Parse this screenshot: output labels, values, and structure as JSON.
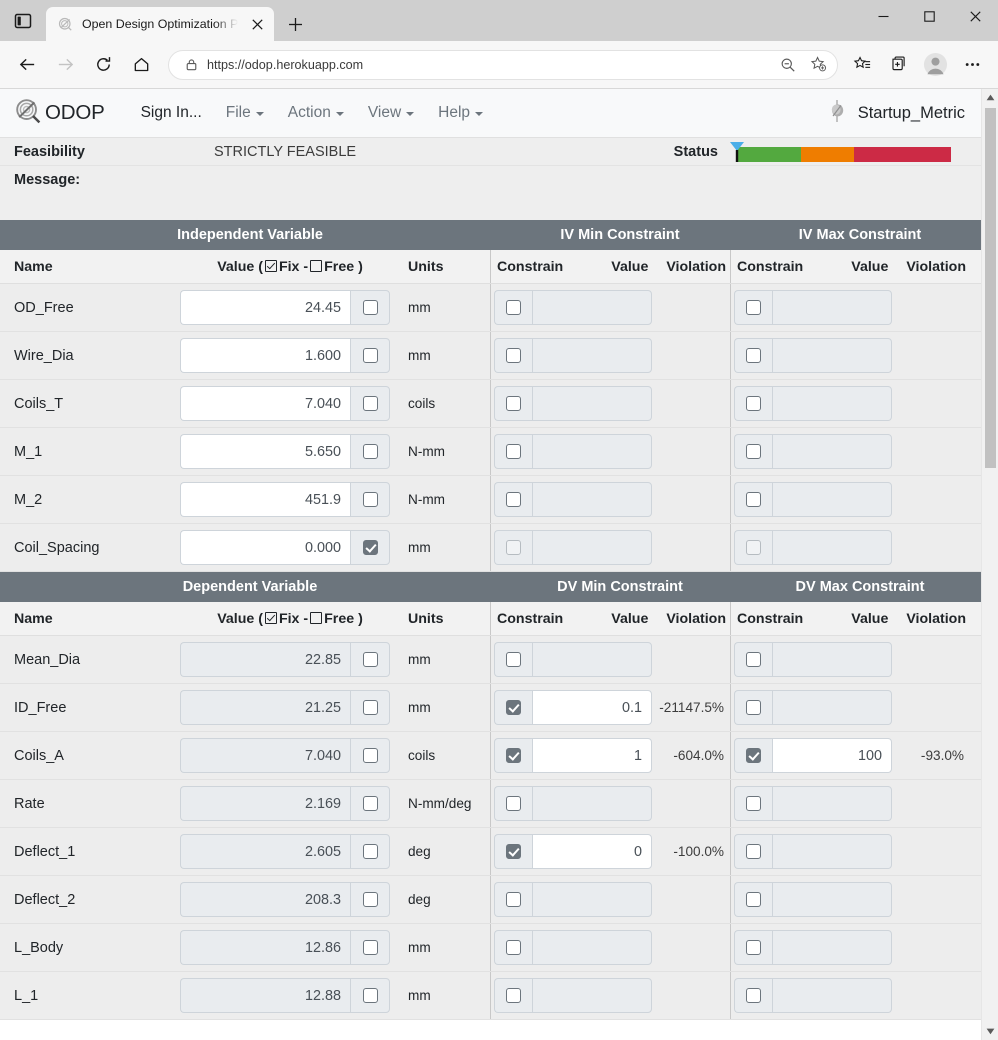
{
  "browser": {
    "tab": {
      "title": "Open Design Optimization Platfo",
      "favicon_icon": "odop-spiral-icon",
      "close_icon": "close-icon",
      "new_tab_icon": "plus-icon",
      "sidebar_icon": "tab-sidebar-icon"
    },
    "window_controls": {
      "minimize_icon": "minimize-icon",
      "maximize_icon": "maximize-icon",
      "close_icon": "close-icon"
    },
    "toolbar": {
      "back_icon": "back-arrow-icon",
      "forward_icon": "forward-arrow-icon",
      "refresh_icon": "refresh-icon",
      "home_icon": "home-icon",
      "lock_icon": "lock-icon",
      "url": "https://odop.herokuapp.com",
      "zoom_icon": "zoom-out-icon",
      "add_favorite_icon": "add-favorite-star-icon",
      "favorites_icon": "favorites-list-icon",
      "collections_icon": "collections-icon",
      "profile_icon": "profile-avatar-icon",
      "settings_icon": "more-ellipsis-icon"
    },
    "scrollbar": {
      "up_icon": "scroll-up-arrow-icon",
      "down_icon": "scroll-down-arrow-icon"
    }
  },
  "app": {
    "brand": {
      "name": "ODOP",
      "logo_icon": "odop-spiral-logo-icon"
    },
    "nav": [
      {
        "label": "Sign In...",
        "has_caret": false,
        "name": "sign-in"
      },
      {
        "label": "File",
        "has_caret": true,
        "name": "file"
      },
      {
        "label": "Action",
        "has_caret": true,
        "name": "action"
      },
      {
        "label": "View",
        "has_caret": true,
        "name": "view"
      },
      {
        "label": "Help",
        "has_caret": true,
        "name": "help"
      }
    ],
    "model": {
      "name": "Startup_Metric",
      "icon": "spring-model-icon"
    },
    "status": {
      "feasibility_label": "Feasibility",
      "feasibility_value": "STRICTLY FEASIBLE",
      "message_label": "Message:",
      "message_value": "",
      "status_label": "Status",
      "marker_icon": "status-marker-triangle-icon",
      "marker_position_pct": 0,
      "segments": [
        {
          "color": "#53a93f",
          "width_pct": 30
        },
        {
          "color": "#ef7d00",
          "width_pct": 25
        },
        {
          "color": "#cc2a45",
          "width_pct": 45
        }
      ]
    }
  },
  "sections": [
    {
      "group_headers": [
        "Independent Variable",
        "IV Min Constraint",
        "IV Max Constraint"
      ],
      "column_headers": {
        "name": "Name",
        "value_prefix": "Value (",
        "value_fix": "Fix",
        "value_dash": "-",
        "value_free": "Free",
        "value_suffix": ")",
        "units": "Units",
        "constrain": "Constrain",
        "cvalue": "Value",
        "violation": "Violation"
      },
      "rows": [
        {
          "name": "OD_Free",
          "value": "24.45",
          "fix": false,
          "units": "mm",
          "min": {
            "constrain": false,
            "value": "",
            "violation": ""
          },
          "max": {
            "constrain": false,
            "value": "",
            "violation": ""
          }
        },
        {
          "name": "Wire_Dia",
          "value": "1.600",
          "fix": false,
          "units": "mm",
          "min": {
            "constrain": false,
            "value": "",
            "violation": ""
          },
          "max": {
            "constrain": false,
            "value": "",
            "violation": ""
          }
        },
        {
          "name": "Coils_T",
          "value": "7.040",
          "fix": false,
          "units": "coils",
          "min": {
            "constrain": false,
            "value": "",
            "violation": ""
          },
          "max": {
            "constrain": false,
            "value": "",
            "violation": ""
          }
        },
        {
          "name": "M_1",
          "value": "5.650",
          "fix": false,
          "units": "N-mm",
          "min": {
            "constrain": false,
            "value": "",
            "violation": ""
          },
          "max": {
            "constrain": false,
            "value": "",
            "violation": ""
          }
        },
        {
          "name": "M_2",
          "value": "451.9",
          "fix": false,
          "units": "N-mm",
          "min": {
            "constrain": false,
            "value": "",
            "violation": ""
          },
          "max": {
            "constrain": false,
            "value": "",
            "violation": ""
          }
        },
        {
          "name": "Coil_Spacing",
          "value": "0.000",
          "fix": true,
          "units": "mm",
          "min": {
            "constrain": false,
            "value": "",
            "violation": "",
            "disabled": true
          },
          "max": {
            "constrain": false,
            "value": "",
            "violation": "",
            "disabled": true
          }
        }
      ]
    },
    {
      "group_headers": [
        "Dependent Variable",
        "DV Min Constraint",
        "DV Max Constraint"
      ],
      "column_headers": {
        "name": "Name",
        "value_prefix": "Value (",
        "value_fix": "Fix",
        "value_dash": "-",
        "value_free": "Free",
        "value_suffix": ")",
        "units": "Units",
        "constrain": "Constrain",
        "cvalue": "Value",
        "violation": "Violation"
      },
      "rows": [
        {
          "name": "Mean_Dia",
          "value": "22.85",
          "fix": false,
          "units": "mm",
          "readonly": true,
          "min": {
            "constrain": false,
            "value": "",
            "violation": ""
          },
          "max": {
            "constrain": false,
            "value": "",
            "violation": ""
          }
        },
        {
          "name": "ID_Free",
          "value": "21.25",
          "fix": false,
          "units": "mm",
          "readonly": true,
          "min": {
            "constrain": true,
            "value": "0.1",
            "violation": "-21147.5%"
          },
          "max": {
            "constrain": false,
            "value": "",
            "violation": ""
          }
        },
        {
          "name": "Coils_A",
          "value": "7.040",
          "fix": false,
          "units": "coils",
          "readonly": true,
          "min": {
            "constrain": true,
            "value": "1",
            "violation": "-604.0%"
          },
          "max": {
            "constrain": true,
            "value": "100",
            "violation": "-93.0%"
          }
        },
        {
          "name": "Rate",
          "value": "2.169",
          "fix": false,
          "units": "N-mm/deg",
          "readonly": true,
          "min": {
            "constrain": false,
            "value": "",
            "violation": ""
          },
          "max": {
            "constrain": false,
            "value": "",
            "violation": ""
          }
        },
        {
          "name": "Deflect_1",
          "value": "2.605",
          "fix": false,
          "units": "deg",
          "readonly": true,
          "min": {
            "constrain": true,
            "value": "0",
            "violation": "-100.0%"
          },
          "max": {
            "constrain": false,
            "value": "",
            "violation": ""
          }
        },
        {
          "name": "Deflect_2",
          "value": "208.3",
          "fix": false,
          "units": "deg",
          "readonly": true,
          "min": {
            "constrain": false,
            "value": "",
            "violation": ""
          },
          "max": {
            "constrain": false,
            "value": "",
            "violation": ""
          }
        },
        {
          "name": "L_Body",
          "value": "12.86",
          "fix": false,
          "units": "mm",
          "readonly": true,
          "min": {
            "constrain": false,
            "value": "",
            "violation": ""
          },
          "max": {
            "constrain": false,
            "value": "",
            "violation": ""
          }
        },
        {
          "name": "L_1",
          "value": "12.88",
          "fix": false,
          "units": "mm",
          "readonly": true,
          "min": {
            "constrain": false,
            "value": "",
            "violation": ""
          },
          "max": {
            "constrain": false,
            "value": "",
            "violation": ""
          }
        }
      ]
    }
  ]
}
